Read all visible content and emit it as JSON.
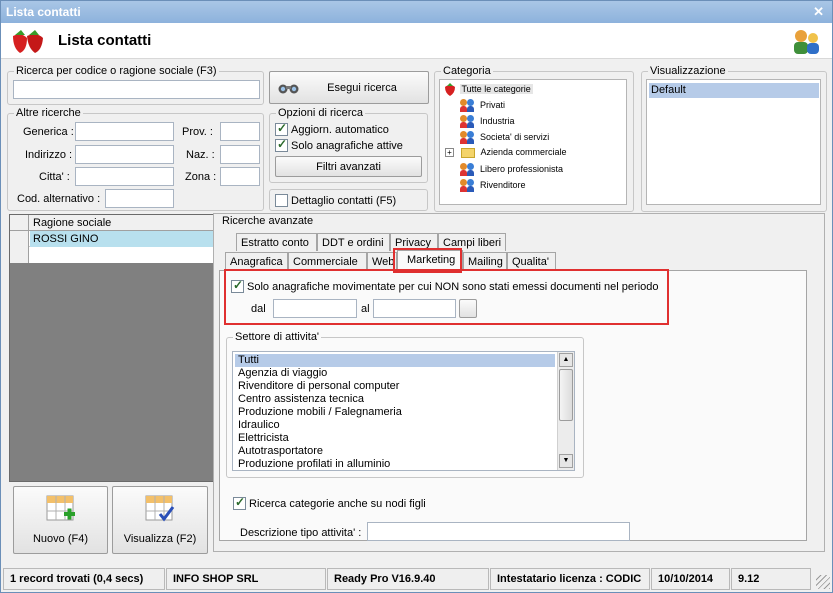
{
  "window": {
    "title": "Lista contatti",
    "app_title": "Lista contatti"
  },
  "search": {
    "code_legend": "Ricerca per codice o ragione sociale (F3)",
    "code_value": "",
    "exec_button": "Esegui ricerca",
    "other_legend": "Altre ricerche",
    "fields": {
      "generica": "Generica :",
      "indirizzo": "Indirizzo :",
      "citta": "Citta' :",
      "cod_alt": "Cod. alternativo :",
      "prov": "Prov. :",
      "naz": "Naz. :",
      "zona": "Zona :"
    },
    "options_legend": "Opzioni di ricerca",
    "opt_aggiorn": "Aggiorn. automatico",
    "opt_solo": "Solo anagrafiche attive",
    "filtri_button": "Filtri avanzati",
    "dettaglio": "Dettaglio contatti (F5)"
  },
  "categoria": {
    "legend": "Categoria",
    "items": [
      "Tutte le categorie",
      "Privati",
      "Industria",
      "Societa' di servizi",
      "Azienda commerciale",
      "Libero professionista",
      "Rivenditore"
    ]
  },
  "visualizzazione": {
    "legend": "Visualizzazione",
    "selected": "Default"
  },
  "grid": {
    "header": "Ragione sociale",
    "rows": [
      "ROSSI GINO"
    ]
  },
  "advanced": {
    "legend": "Ricerche avanzate",
    "tabs_row1": [
      "Estratto conto",
      "DDT e ordini",
      "Privacy",
      "Campi liberi"
    ],
    "tabs_row2": [
      "Anagrafica",
      "Commerciale",
      "Web",
      "Marketing",
      "Mailing",
      "Qualita'"
    ],
    "active_tab": "Marketing",
    "solo_label": "Solo anagrafiche movimentate per cui NON sono stati emessi documenti nel periodo",
    "dal": "dal",
    "al": "al",
    "settore_legend": "Settore di attivita'",
    "settori": [
      "Tutti",
      "Agenzia di viaggio",
      "Rivenditore di personal computer",
      "Centro assistenza tecnica",
      "Produzione mobili / Falegnameria",
      "Idraulico",
      "Elettricista",
      "Autotrasportatore",
      "Produzione profilati in alluminio"
    ],
    "ricerca_categorie": "Ricerca categorie anche su nodi figli",
    "descrizione_label": "Descrizione tipo attivita' :"
  },
  "buttons": {
    "nuovo": "Nuovo (F4)",
    "visualizza": "Visualizza (F2)"
  },
  "status": {
    "records": "1 record trovati (0,4 secs)",
    "company": "INFO SHOP SRL",
    "version": "Ready Pro V16.9.40",
    "license": "Intestatario licenza : CODIC",
    "date": "10/10/2014",
    "time": "9.12"
  }
}
